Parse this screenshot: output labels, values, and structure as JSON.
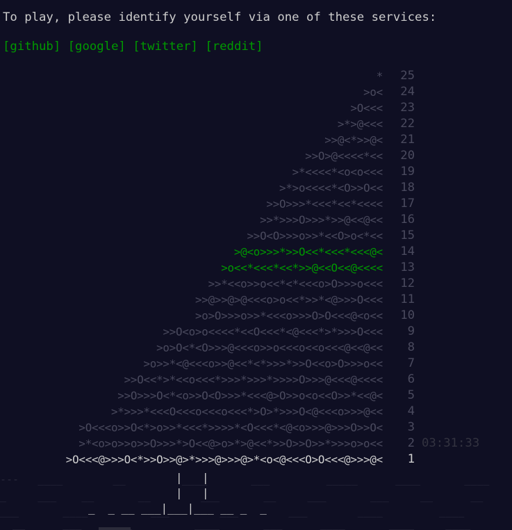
{
  "intro": {
    "text": "To play, please identify yourself via one of these services:"
  },
  "services": {
    "github": "[github]",
    "google": "[google]",
    "twitter": "[twitter]",
    "reddit": "[reddit]"
  },
  "calendar": {
    "rows": [
      {
        "day": "25",
        "tree": "*"
      },
      {
        "day": "24",
        "tree": ">o<"
      },
      {
        "day": "23",
        "tree": ">O<<<"
      },
      {
        "day": "22",
        "tree": ">*>@<<<"
      },
      {
        "day": "21",
        "tree": ">>@<*>>@<"
      },
      {
        "day": "20",
        "tree": ">>O>@<<<<*<<"
      },
      {
        "day": "19",
        "tree": ">*<<<<*<o<o<<<"
      },
      {
        "day": "18",
        "tree": ">*>o<<<<*<O>>O<<"
      },
      {
        "day": "17",
        "tree": ">>O>>>*<<<*<<*<<<<"
      },
      {
        "day": "16",
        "tree": ">>*>>>O>>>*>>@<<@<<"
      },
      {
        "day": "15",
        "tree": ">>O<O>>>o>>*<<O>o<*<<"
      },
      {
        "day": "14",
        "tree": ">@<o>>>*>>O<<*<<<*<<<@<"
      },
      {
        "day": "13",
        "tree": ">o<<*<<<*<<*>>@<<O<<@<<<<"
      },
      {
        "day": "12",
        "tree": ">>*<<o>>o<<*<*<<<o>O>>>o<<<"
      },
      {
        "day": "11",
        "tree": ">>@>>@>@<<<o>o<<*>>*<@>>>O<<<"
      },
      {
        "day": "10",
        "tree": ">o>O>>>o>>*<<<o>>>O>O<<<@<o<<"
      },
      {
        "day": "9",
        "tree": ">>O<o>o<<<<*<<O<<<*<@<<<*>*>>>O<<<"
      },
      {
        "day": "8",
        "tree": ">o>O<*<O>>>@<<<o>>o<<<o<<o<<<@<<@<<"
      },
      {
        "day": "7",
        "tree": ">o>>*<@<<<o>>@<<*<*>>>*>>O<<o>O>>>o<<"
      },
      {
        "day": "6",
        "tree": ">>O<<*>*<<o<<<*>>>*>>>*>>>>O>>>@<<<@<<<<"
      },
      {
        "day": "5",
        "tree": ">>O>>>O<*<o>>O<O>>>*<<<@>O>>o<o<<O>>*<<@<"
      },
      {
        "day": "4",
        "tree": ">*>>>*<<<O<<<o<<<o<<<*>O>*>>>O<@<<<o>>>@<<"
      },
      {
        "day": "3",
        "tree": ">O<<<o>>O<*>o>>*<<<*>>>>*<O<<<*<@<o>>>@>>>O>>O<"
      },
      {
        "day": "2",
        "tree": ">*<o>o>>o>>O>>>*>O<<@>o>*>@<<*>>O>>O>>*>>>o>o<<"
      },
      {
        "day": "1",
        "tree": ">O<<<@>>>O<*>>O>>@>*>>>@>>>@>*<o<@<<<O>O<<<@>>>@<"
      }
    ],
    "countdown": "03:31:33"
  },
  "trunk": {
    "line1": "|   |",
    "line2": "|   |",
    "line3": "_  _ __ ___|___|___ __ _  _"
  }
}
